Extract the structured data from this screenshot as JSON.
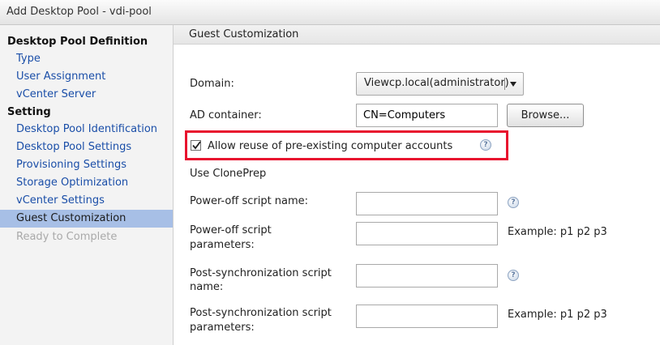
{
  "window": {
    "title": "Add Desktop Pool - vdi-pool"
  },
  "sidebar": {
    "section1": "Desktop Pool Definition",
    "items1": [
      "Type",
      "User Assignment",
      "vCenter Server"
    ],
    "section2": "Setting",
    "items2": [
      "Desktop Pool Identification",
      "Desktop Pool Settings",
      "Provisioning Settings",
      "Storage Optimization",
      "vCenter Settings",
      "Guest Customization",
      "Ready to Complete"
    ],
    "active": "Guest Customization",
    "disabled": "Ready to Complete"
  },
  "content": {
    "section_title": "Guest Customization",
    "domain": {
      "label": "Domain:",
      "value": "Viewcp.local(administrator)"
    },
    "ad_container": {
      "label": "AD container:",
      "value": "CN=Computers",
      "browse_label": "Browse..."
    },
    "allow_reuse": {
      "label": "Allow reuse of pre-existing computer accounts",
      "checked": true
    },
    "use_cloneprep": "Use ClonePrep",
    "poweroff_script_name": {
      "label": "Power-off script name:",
      "value": ""
    },
    "poweroff_script_params": {
      "label_line1": "Power-off script",
      "label_line2": "parameters:",
      "value": "",
      "example": "Example: p1 p2 p3"
    },
    "postsync_script_name": {
      "label_line1": "Post-synchronization script",
      "label_line2": "name:",
      "value": ""
    },
    "postsync_script_params": {
      "label_line1": "Post-synchronization script",
      "label_line2": "parameters:",
      "value": "",
      "example": "Example: p1 p2 p3"
    },
    "help_glyph": "?"
  },
  "colors": {
    "link": "#1a4ea8",
    "active_bg": "#a7bfe6",
    "highlight_border": "#e8122e",
    "disabled": "#a9a9a9"
  },
  "icons": [
    "help-icon",
    "dropdown-arrow-icon",
    "checkmark-icon"
  ]
}
